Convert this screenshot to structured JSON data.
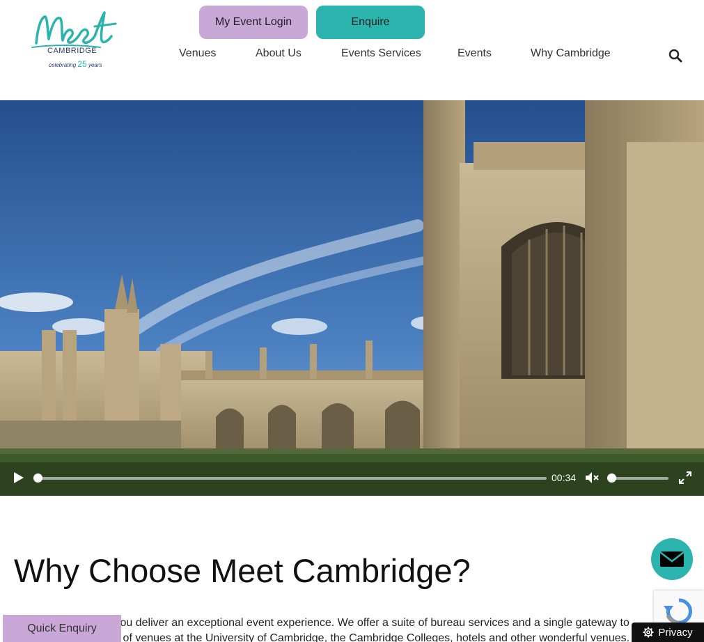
{
  "header": {
    "logo": {
      "wordmark": "Meet",
      "city": "CAMBRIDGE",
      "tagline_prefix": "celebrating",
      "tagline_number": "25",
      "tagline_suffix": "years"
    },
    "login_label": "My Event Login",
    "enquire_label": "Enquire",
    "nav": [
      "Venues",
      "About Us",
      "Events Services",
      "Events",
      "Why Cambridge"
    ],
    "search_icon": "search-icon"
  },
  "video": {
    "time": "00:34",
    "progress": 0.0,
    "volume": 0.0,
    "muted": true
  },
  "main": {
    "heading": "Why Choose Meet Cambridge?",
    "intro": "d we're here to help you deliver an exceptional event experience. We offer a suite of bureau services and a single gateway to an incredible portfolio of venues at the University of Cambridge, the Cambridge Colleges, hotels and other wonderful venues."
  },
  "widgets": {
    "quick_enquiry": "Quick Enquiry",
    "privacy": "Privacy"
  },
  "colors": {
    "teal": "#2bb3ad",
    "lilac": "#c9a8d8",
    "navy": "#2a3a6a"
  }
}
